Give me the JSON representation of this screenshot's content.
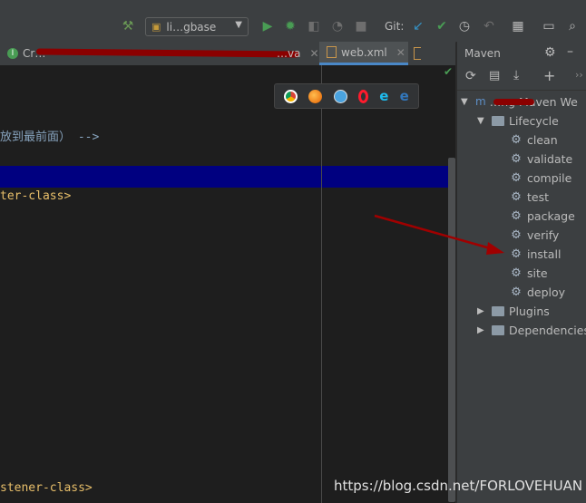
{
  "toolbar": {
    "run_config_label": "li…gbase",
    "git_label": "Git:"
  },
  "tabs": [
    {
      "label": "Cr…",
      "icon": "java-class-icon"
    },
    {
      "label": "…va",
      "icon": "java-class-icon"
    },
    {
      "label": "web.xml",
      "icon": "xml-file-icon"
    }
  ],
  "editor": {
    "line1": "放到最前面） -->",
    "line2": "ter-class>",
    "line3": "stener-class>"
  },
  "browsers": [
    "chrome-icon",
    "firefox-icon",
    "safari-icon",
    "opera-icon",
    "ie-icon",
    "edge-icon"
  ],
  "maven": {
    "title": "Maven",
    "project": "…ng Maven We",
    "lifecycle_label": "Lifecycle",
    "goals": [
      "clean",
      "validate",
      "compile",
      "test",
      "package",
      "verify",
      "install",
      "site",
      "deploy"
    ],
    "plugins_label": "Plugins",
    "dependencies_label": "Dependencies"
  },
  "watermark": "https://blog.csdn.net/FORLOVEHUAN",
  "colors": {
    "accent": "#4a88c7",
    "highlight": "#000080",
    "redmark": "#8b0000"
  }
}
